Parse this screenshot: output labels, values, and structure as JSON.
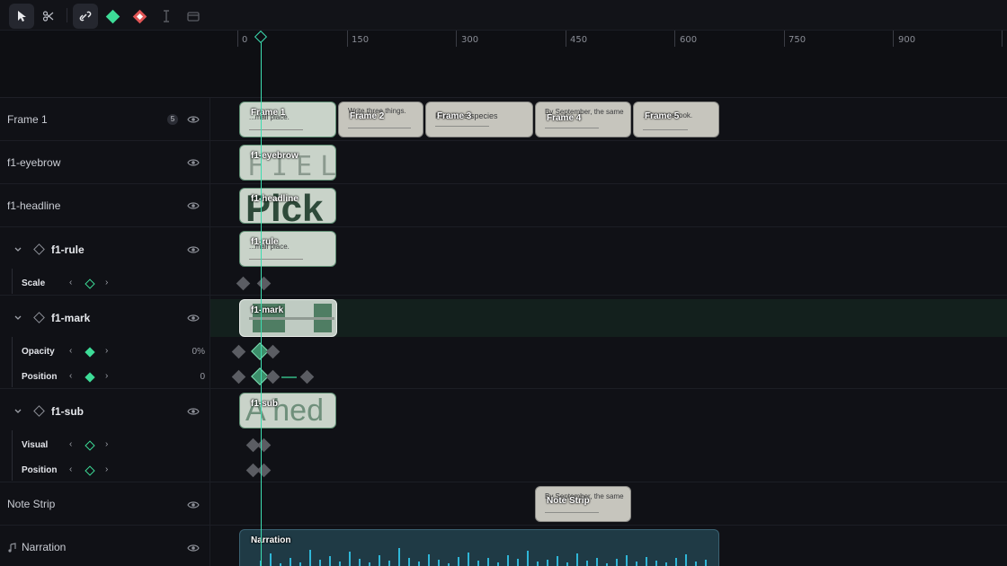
{
  "toolbar": {
    "icons": [
      "select-arrow-icon",
      "scissors-icon",
      "magnet-link-icon",
      "keyframe-add-icon",
      "keyframe-remove-icon",
      "text-cursor-icon",
      "film-icon"
    ]
  },
  "ruler": {
    "ticks": [
      {
        "label": "0"
      },
      {
        "label": "150"
      },
      {
        "label": "300"
      },
      {
        "label": "450"
      },
      {
        "label": "600"
      },
      {
        "label": "750"
      },
      {
        "label": "900"
      }
    ]
  },
  "tracks": {
    "frame1": {
      "label": "Frame 1",
      "badge": "5",
      "clips": [
        {
          "name": "Frame 1",
          "text": "...mall place."
        },
        {
          "name": "Frame 2",
          "text": "Write three things."
        },
        {
          "name": "Frame 3",
          "text": "Plants vs species"
        },
        {
          "name": "Frame 4",
          "text": "By September, the same"
        },
        {
          "name": "Frame 5",
          "text": "...the notebook."
        }
      ]
    },
    "eyebrow": {
      "label": "f1-eyebrow",
      "clip": "f1-eyebrow",
      "clip_text": "FIEL"
    },
    "headline": {
      "label": "f1-headline",
      "clip": "f1-headline",
      "clip_text": "Pick"
    },
    "rule": {
      "label": "f1-rule",
      "clip": "f1-rule",
      "clip_text": "...mall place.",
      "props": [
        {
          "name": "Scale",
          "value": ""
        }
      ]
    },
    "mark": {
      "label": "f1-mark",
      "clip": "f1-mark",
      "props": [
        {
          "name": "Opacity",
          "value": "0%"
        },
        {
          "name": "Position",
          "value": "0"
        }
      ]
    },
    "sub": {
      "label": "f1-sub",
      "clip": "f1-sub",
      "clip_text": "A hed",
      "props": [
        {
          "name": "Visual",
          "value": ""
        },
        {
          "name": "Position",
          "value": ""
        }
      ]
    },
    "note": {
      "label": "Note Strip",
      "clip": "Note Strip",
      "clip_text": "By September, the same"
    },
    "narration": {
      "label": "Narration",
      "clip": "Narration"
    }
  },
  "colors": {
    "accent": "#3ddc97",
    "playhead": "#3ddcb0",
    "audio": "#2fb7d8",
    "remove": "#e05555"
  }
}
